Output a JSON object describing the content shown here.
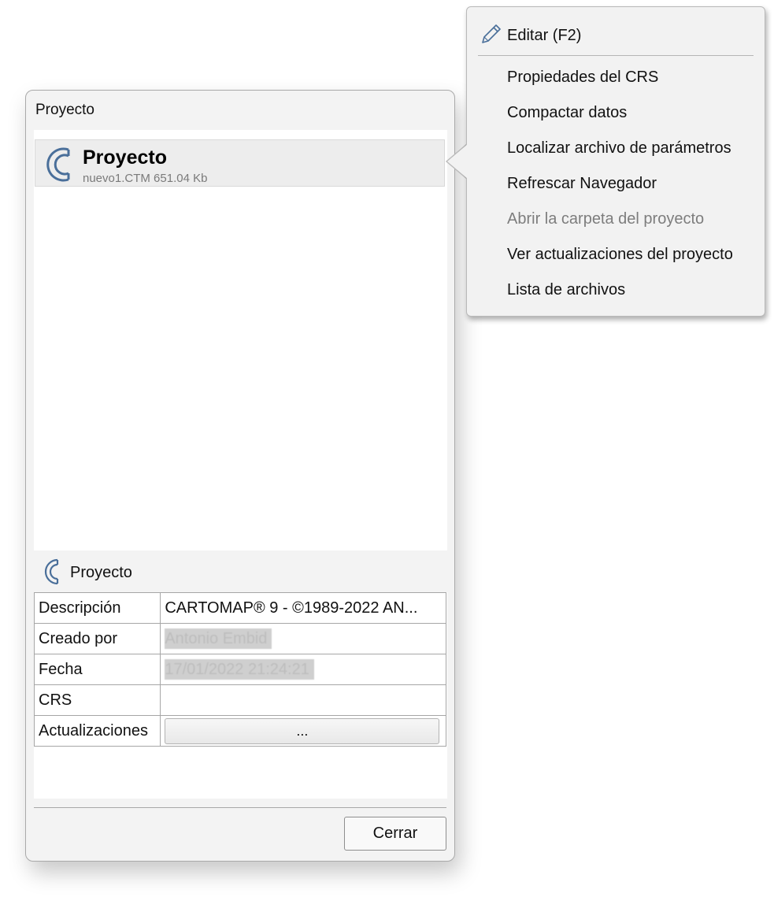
{
  "dialog": {
    "title": "Proyecto",
    "tree": {
      "item_title": "Proyecto",
      "item_subtitle": "nuevo1.CTM 651.04 Kb",
      "icon": "cartomap-logo-icon"
    },
    "section_title": "Proyecto",
    "properties": [
      {
        "key": "Descripción",
        "value": "CARTOMAP® 9 - ©1989-2022 AN..."
      },
      {
        "key": "Creado por",
        "value": "Antonio Embid"
      },
      {
        "key": "Fecha",
        "value": "17/01/2022 21:24:21"
      },
      {
        "key": "CRS",
        "value": ""
      },
      {
        "key": "Actualizaciones",
        "button_label": "..."
      }
    ],
    "close_label": "Cerrar"
  },
  "context_menu": {
    "items": [
      {
        "label": "Editar (F2)",
        "icon": "pencil-icon",
        "enabled": true
      },
      {
        "label": "Propiedades del CRS",
        "enabled": true
      },
      {
        "label": "Compactar datos",
        "enabled": true
      },
      {
        "label": "Localizar archivo de parámetros",
        "enabled": true
      },
      {
        "label": "Refrescar Navegador",
        "enabled": true
      },
      {
        "label": "Abrir la carpeta del proyecto",
        "enabled": false
      },
      {
        "label": "Ver actualizaciones del proyecto",
        "enabled": true
      },
      {
        "label": "Lista de archivos",
        "enabled": true
      }
    ]
  },
  "colors": {
    "logo": "#4a6f9a",
    "disabled_text": "#7d7d7d"
  }
}
